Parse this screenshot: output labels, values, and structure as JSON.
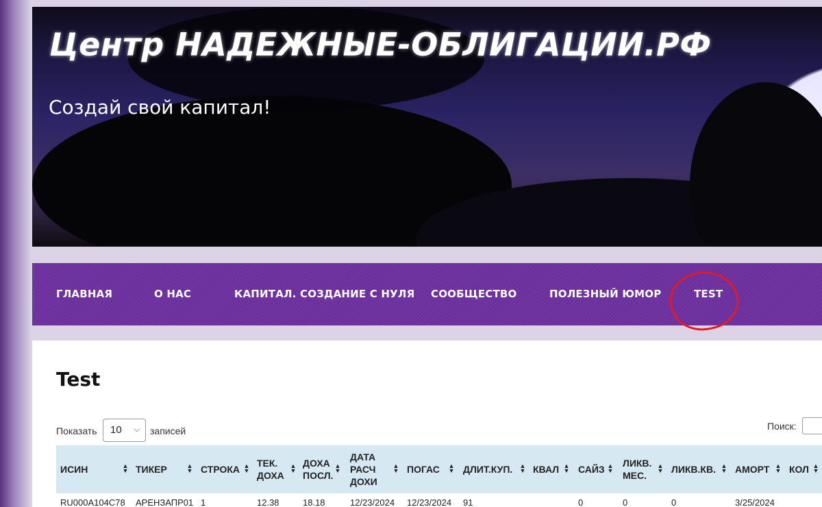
{
  "site": {
    "title": "Центр НАДЕЖНЫЕ-ОБЛИГАЦИИ.РФ",
    "subtitle": "Создай свой капитал!"
  },
  "nav": {
    "items": [
      "ГЛАВНАЯ",
      "О НАС",
      "КАПИТАЛ. СОЗДАНИЕ С НУЛЯ",
      "СООБЩЕСТВО",
      "ПОЛЕЗНЫЙ ЮМОР",
      "TEST"
    ]
  },
  "page": {
    "title": "Test"
  },
  "table_controls": {
    "show_label": "Показать",
    "entries_value": "10",
    "entries_label": "записей",
    "search_label": "Поиск:",
    "search_value": ""
  },
  "table": {
    "columns": [
      {
        "label": "ИСИН"
      },
      {
        "label": "ТИКЕР"
      },
      {
        "label": "СТРОКА"
      },
      {
        "label": "ТЕК. ДОХА"
      },
      {
        "label": "ДОХА ПОСЛ."
      },
      {
        "label": "ДАТА РАСЧ ДОХИ"
      },
      {
        "label": "ПОГАС"
      },
      {
        "label": "ДЛИТ.КУП."
      },
      {
        "label": "КВАЛ"
      },
      {
        "label": "САЙЗ"
      },
      {
        "label": "ЛИКВ. МЕС."
      },
      {
        "label": "ЛИКВ.КВ."
      },
      {
        "label": "АМОРТ"
      },
      {
        "label": "КОЛ"
      }
    ],
    "rows": [
      [
        "RU000A104C78",
        "АРЕНЗАПР01",
        "1",
        "12.38",
        "18.18",
        "12/23/2024",
        "12/23/2024",
        "91",
        "",
        "0",
        "0",
        "0",
        "3/25/2024",
        ""
      ]
    ]
  },
  "colors": {
    "nav_bg": "#6a2f9a",
    "table_header_bg": "#d6e8f2",
    "annotation": "#e01b24"
  }
}
